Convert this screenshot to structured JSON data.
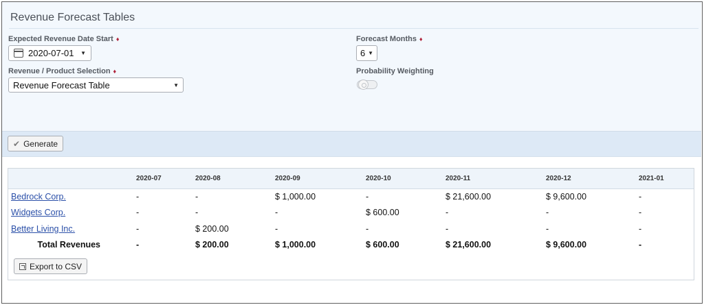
{
  "title": "Revenue Forecast Tables",
  "fields": {
    "date_start": {
      "label": "Expected Revenue Date Start",
      "required_mark": "♦",
      "value": "2020-07-01"
    },
    "forecast_months": {
      "label": "Forecast Months",
      "required_mark": "♦",
      "value": "6"
    },
    "selection": {
      "label": "Revenue / Product Selection",
      "required_mark": "♦",
      "value": "Revenue Forecast Table"
    },
    "probability": {
      "label": "Probability Weighting",
      "enabled": false
    }
  },
  "icons": {
    "calendar": "calendar-icon",
    "caret": "▼",
    "check": "✔",
    "export": "export-icon"
  },
  "generate_button": {
    "icon": "✔",
    "label": "Generate"
  },
  "export_button": {
    "label": "Export to CSV"
  },
  "table": {
    "columns": [
      "",
      "2020-07",
      "2020-08",
      "2020-09",
      "2020-10",
      "2020-11",
      "2020-12",
      "2021-01"
    ],
    "rows": [
      {
        "name": "Bedrock Corp.",
        "cells": [
          "-",
          "-",
          "$ 1,000.00",
          "-",
          "$ 21,600.00",
          "$ 9,600.00",
          "-"
        ]
      },
      {
        "name": "Widgets Corp.",
        "cells": [
          "-",
          "-",
          "-",
          "$ 600.00",
          "-",
          "-",
          "-"
        ]
      },
      {
        "name": "Better Living Inc.",
        "cells": [
          "-",
          "$ 200.00",
          "-",
          "-",
          "-",
          "-",
          "-"
        ]
      }
    ],
    "total": {
      "name": "Total Revenues",
      "cells": [
        "-",
        "$ 200.00",
        "$ 1,000.00",
        "$ 600.00",
        "$ 21,600.00",
        "$ 9,600.00",
        "-"
      ]
    }
  },
  "colors": {
    "panel_bg": "#f3f8fd",
    "action_bar_bg": "#dde9f6",
    "link": "#2a4fa8",
    "required": "#b0243b"
  }
}
